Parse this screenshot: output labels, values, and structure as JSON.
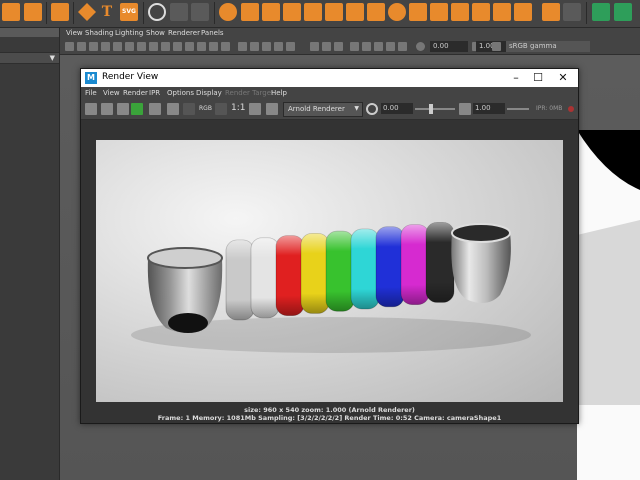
{
  "shelf": {
    "text_icons": [
      "T",
      "SVG"
    ]
  },
  "viewport": {
    "menu": [
      "View",
      "Shading",
      "Lighting",
      "Show",
      "Renderer",
      "Panels"
    ],
    "exposure_value": "0.00",
    "gamma_value": "1.00",
    "colorspace": "sRGB gamma"
  },
  "render_view": {
    "title": "Render View",
    "menu": [
      "File",
      "View",
      "Render",
      "IPR",
      "Options",
      "Display",
      "Render Target",
      "Help"
    ],
    "rgb_label": "RGB",
    "ratio_label": "1:1",
    "renderer": "Arnold Renderer",
    "exposure_value": "0.00",
    "gamma_value": "1.00",
    "ipr_label": "IPR: 0MB",
    "status_line1": "size: 960 x 540 zoom: 1.000    (Arnold Renderer)",
    "status_line2": "Frame: 1    Memory: 1081Mb    Sampling: [3/2/2/2/2/2]    Render Time: 0:52    Camera: cameraShape1"
  },
  "render_objects": {
    "ring_colors": [
      "#c9c9c9",
      "#e4e4e4",
      "#e02020",
      "#e8d21a",
      "#38c22e",
      "#2ed6d6",
      "#2030d8",
      "#d62ad0",
      "#2a2a2a"
    ],
    "cup_left": "glass-cup",
    "cup_right": "metal-cup"
  }
}
